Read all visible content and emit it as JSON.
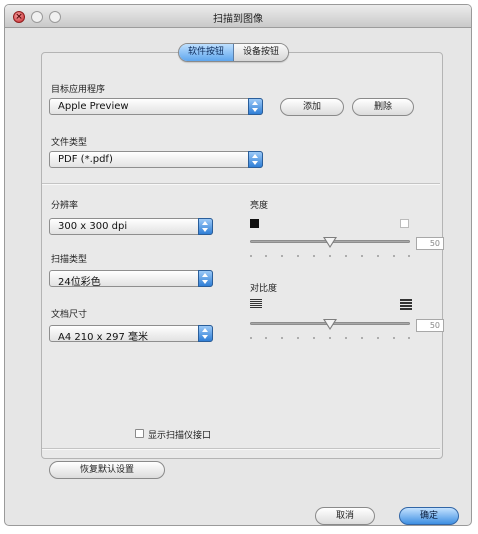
{
  "window": {
    "title": "扫描到图像"
  },
  "tabs": [
    {
      "label": "软件按钮",
      "active": true
    },
    {
      "label": "设备按钮",
      "active": false
    }
  ],
  "target_app": {
    "label": "目标应用程序",
    "value": "Apple Preview",
    "add_label": "添加",
    "delete_label": "删除"
  },
  "file_type": {
    "label": "文件类型",
    "value": "PDF (*.pdf)"
  },
  "resolution": {
    "label": "分辨率",
    "value": "300 x 300 dpi"
  },
  "scan_type": {
    "label": "扫描类型",
    "value": "24位彩色"
  },
  "document_size": {
    "label": "文档尺寸",
    "value": "A4  210 x 297 毫米"
  },
  "brightness": {
    "label": "亮度",
    "value": "50",
    "level": 0.5
  },
  "contrast": {
    "label": "对比度",
    "value": "50",
    "level": 0.5
  },
  "show_interface": {
    "label": "显示扫描仪接口",
    "checked": false
  },
  "restore_defaults_label": "恢复默认设置",
  "footer": {
    "cancel_label": "取消",
    "ok_label": "确定"
  },
  "colors": {
    "accent": "#3e8fe2",
    "close": "#c7282d"
  }
}
